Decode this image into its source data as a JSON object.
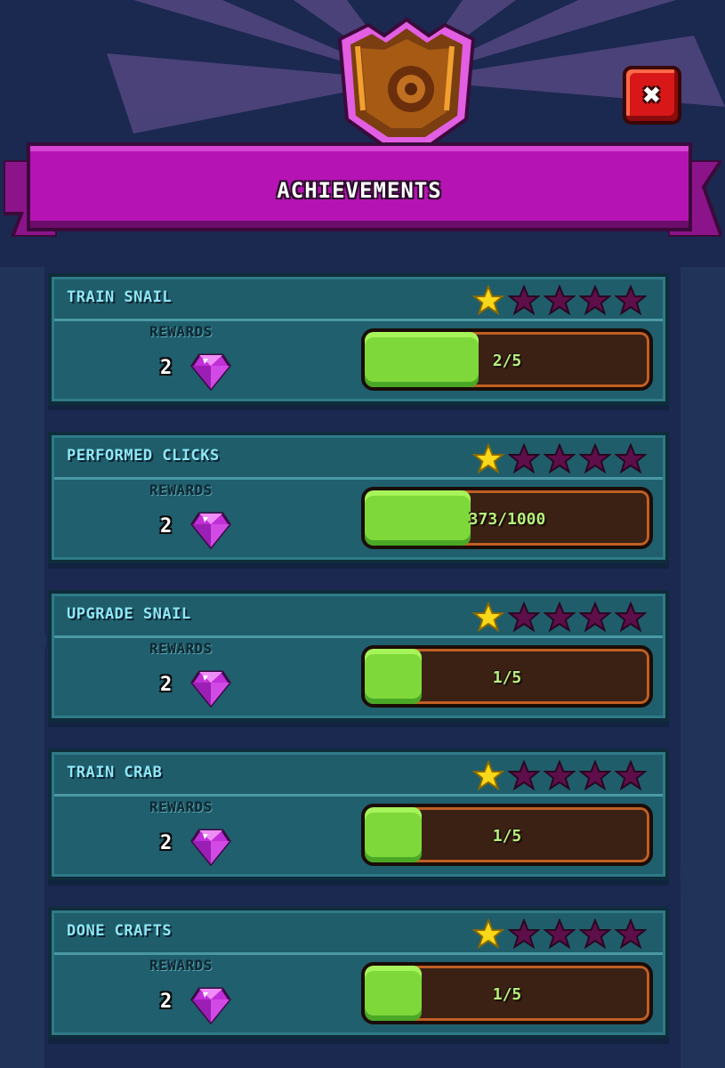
{
  "header": {
    "title": "ACHIEVEMENTS",
    "close_label": "✖"
  },
  "colors": {
    "banner": "#b613b4",
    "close": "#d81818",
    "card": "#1e5b67",
    "progress_fill": "#7ed83a",
    "progress_track": "#3a2114",
    "star_filled": "#f8d81a",
    "star_empty": "#5e0f4a"
  },
  "achievements": [
    {
      "title": "TRAIN SNAIL",
      "stars_filled": 1,
      "stars_total": 5,
      "rewards_label": "REWARDS",
      "reward_amount": "2",
      "reward_icon": "gem-icon",
      "progress_text": "2/5",
      "progress_fraction": 0.4
    },
    {
      "title": "PERFORMED CLICKS",
      "stars_filled": 1,
      "stars_total": 5,
      "rewards_label": "REWARDS",
      "reward_amount": "2",
      "reward_icon": "gem-icon",
      "progress_text": "373/1000",
      "progress_fraction": 0.373
    },
    {
      "title": "UPGRADE SNAIL",
      "stars_filled": 1,
      "stars_total": 5,
      "rewards_label": "REWARDS",
      "reward_amount": "2",
      "reward_icon": "gem-icon",
      "progress_text": "1/5",
      "progress_fraction": 0.2
    },
    {
      "title": "TRAIN CRAB",
      "stars_filled": 1,
      "stars_total": 5,
      "rewards_label": "REWARDS",
      "reward_amount": "2",
      "reward_icon": "gem-icon",
      "progress_text": "1/5",
      "progress_fraction": 0.2
    },
    {
      "title": "DONE CRAFTS",
      "stars_filled": 1,
      "stars_total": 5,
      "rewards_label": "REWARDS",
      "reward_amount": "2",
      "reward_icon": "gem-icon",
      "progress_text": "1/5",
      "progress_fraction": 0.2
    }
  ]
}
